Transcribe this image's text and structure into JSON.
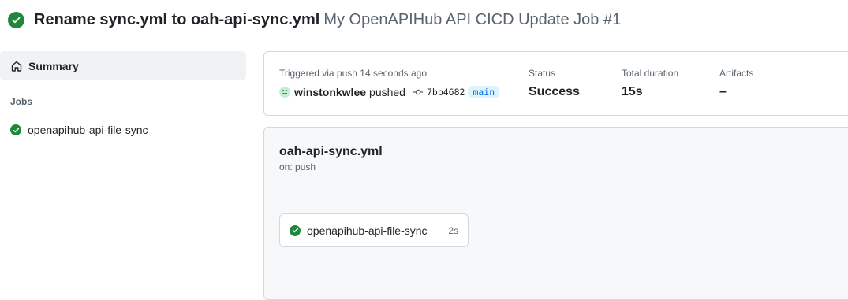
{
  "header": {
    "title": "Rename sync.yml to oah-api-sync.yml",
    "subtitle": "My OpenAPIHub API CICD Update Job #1",
    "status_icon": "check-circle-fill-icon"
  },
  "sidebar": {
    "summary_label": "Summary",
    "summary_icon": "home-icon",
    "jobs_heading": "Jobs",
    "jobs": [
      {
        "label": "openapihub-api-file-sync",
        "status": "success"
      }
    ]
  },
  "run": {
    "trigger_label": "Triggered via push 14 seconds ago",
    "user": "winstonkwlee",
    "action": "pushed",
    "commit_sha": "7bb4682",
    "branch": "main",
    "status_label": "Status",
    "status_value": "Success",
    "duration_label": "Total duration",
    "duration_value": "15s",
    "artifacts_label": "Artifacts",
    "artifacts_value": "–"
  },
  "workflow": {
    "file": "oah-api-sync.yml",
    "trigger": "on: push",
    "jobs": [
      {
        "label": "openapihub-api-file-sync",
        "duration": "2s",
        "status": "success"
      }
    ]
  },
  "colors": {
    "success": "#1f883d",
    "link": "#0969da",
    "muted": "#59636e"
  }
}
